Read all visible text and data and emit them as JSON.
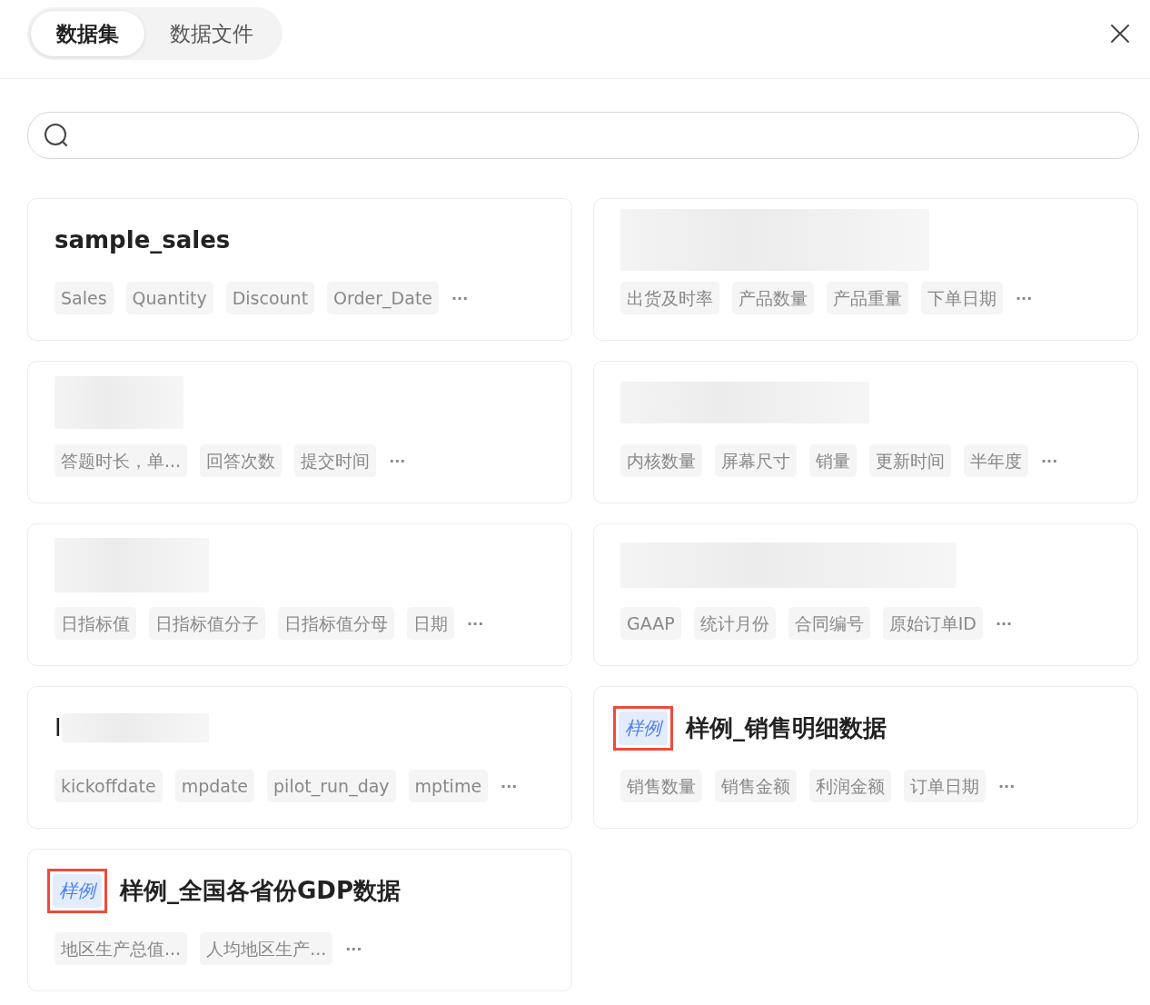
{
  "tabs": [
    {
      "label": "数据集",
      "selected": true
    },
    {
      "label": "数据文件",
      "selected": false
    }
  ],
  "cards": [
    {
      "title": "sample_sales",
      "title_blurred": false,
      "fields": [
        "Sales",
        "Quantity",
        "Discount",
        "Order_Date"
      ],
      "more": "···"
    },
    {
      "title_blurred": true,
      "fields": [
        "出货及时率",
        "产品数量",
        "产品重量",
        "下单日期"
      ],
      "more": "···"
    },
    {
      "title_blurred": true,
      "fields": [
        "答题时长，单...",
        "回答次数",
        "提交时间"
      ],
      "more": "···"
    },
    {
      "title_blurred": true,
      "fields": [
        "内核数量",
        "屏幕尺寸",
        "销量",
        "更新时间",
        "半年度"
      ],
      "more": "···"
    },
    {
      "title_blurred": true,
      "fields": [
        "日指标值",
        "日指标值分子",
        "日指标值分母",
        "日期"
      ],
      "more": "···"
    },
    {
      "title_blurred": true,
      "fields": [
        "GAAP",
        "统计月份",
        "合同编号",
        "原始订单ID"
      ],
      "more": "···"
    },
    {
      "title": "I",
      "title_blurred": true,
      "fields": [
        "kickoffdate",
        "mpdate",
        "pilot_run_day",
        "mptime"
      ],
      "more": "···"
    },
    {
      "title": "样例_销售明细数据",
      "title_blurred": false,
      "sample_badge": {
        "label": "样例",
        "highlighted": true
      },
      "fields": [
        "销售数量",
        "销售金额",
        "利润金额",
        "订单日期"
      ],
      "more": "···"
    },
    {
      "title": "样例_全国各省份GDP数据",
      "title_blurred": false,
      "sample_badge": {
        "label": "样例",
        "highlighted": true
      },
      "fields": [
        "地区生产总值...",
        "人均地区生产..."
      ],
      "more": "···"
    }
  ]
}
